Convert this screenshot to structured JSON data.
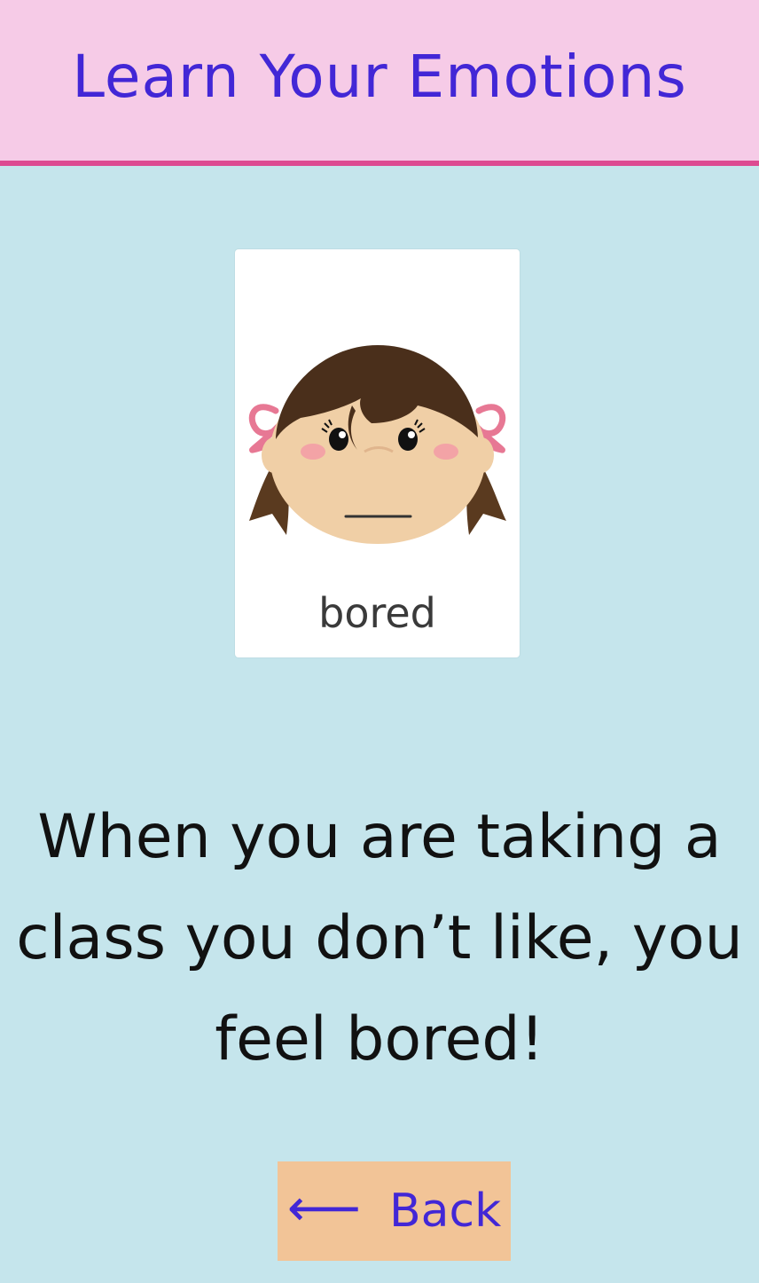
{
  "header": {
    "title": "Learn Your Emotions"
  },
  "card": {
    "image_icon": "bored-girl-face-icon",
    "word": "bored"
  },
  "main": {
    "description": "When you are taking a class you don’t like, you feel bored!"
  },
  "back_button": {
    "arrow": "⟵",
    "label": "Back"
  },
  "colors": {
    "background": "#c5e5ec",
    "header_background": "#f6cbe7",
    "header_border": "#dd4a91",
    "title_text": "#4227d6",
    "button_background": "#f2c497",
    "body_text": "#111111"
  }
}
